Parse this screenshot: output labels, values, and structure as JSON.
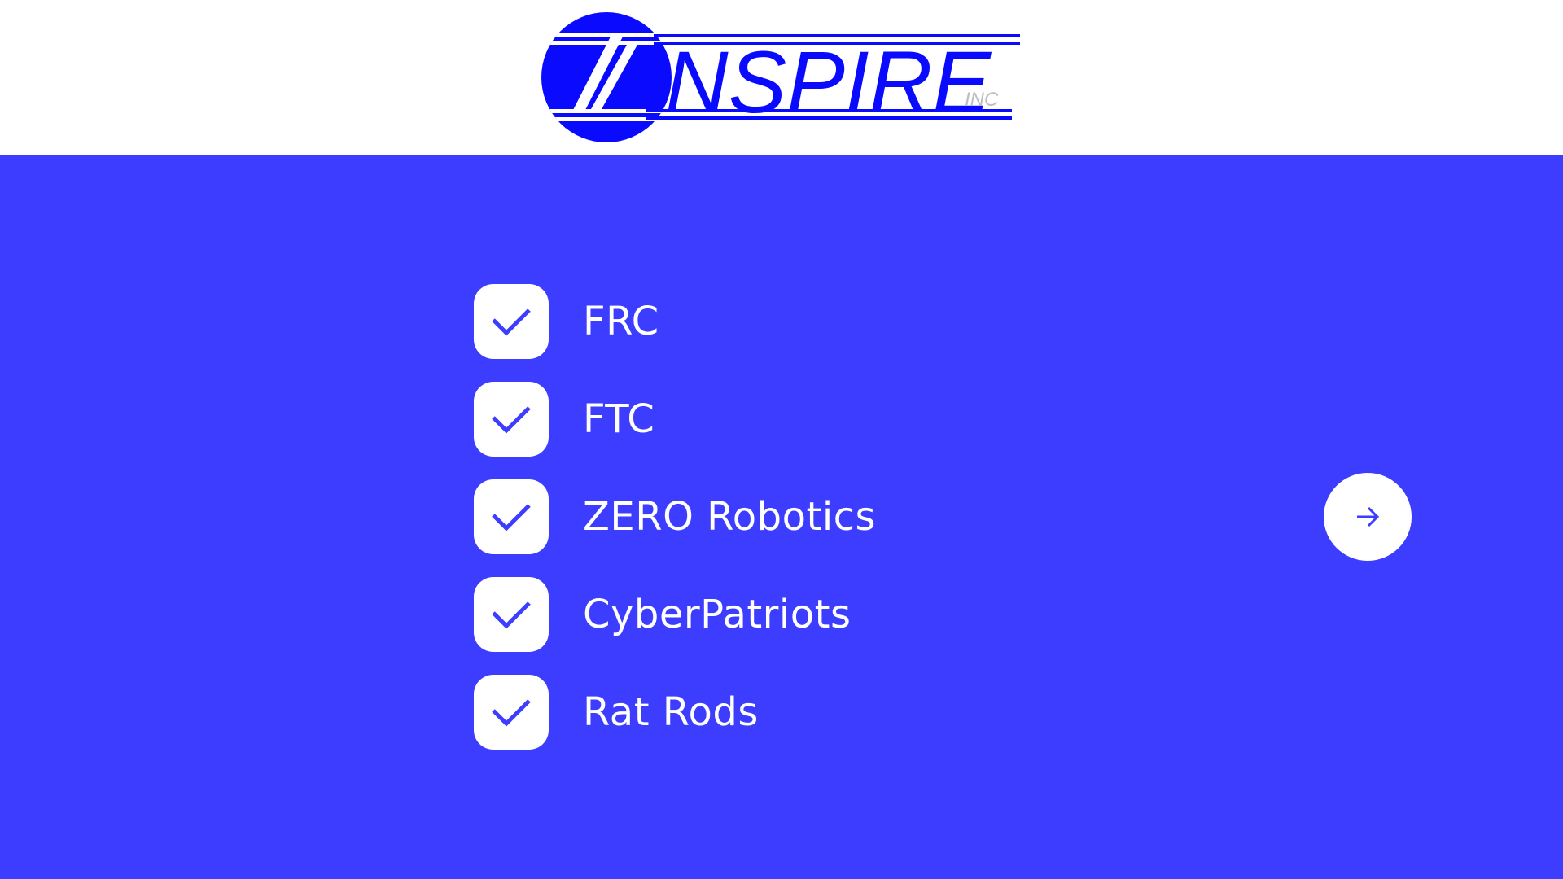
{
  "header": {
    "logo": {
      "main_text": "NSPIRE",
      "small_text": "INC",
      "icon": "inspire-logo-icon"
    }
  },
  "colors": {
    "brand_blue": "#0a0aff",
    "background_blue": "#3c3dfe",
    "white": "#ffffff",
    "inc_gray": "#bdbdbd"
  },
  "checklist": {
    "icon": "checkmark-icon",
    "items": [
      {
        "label": "FRC"
      },
      {
        "label": "FTC"
      },
      {
        "label": "ZERO Robotics"
      },
      {
        "label": "CyberPatriots"
      },
      {
        "label": "Rat Rods"
      }
    ]
  },
  "navigation": {
    "next_icon": "arrow-right-icon"
  }
}
